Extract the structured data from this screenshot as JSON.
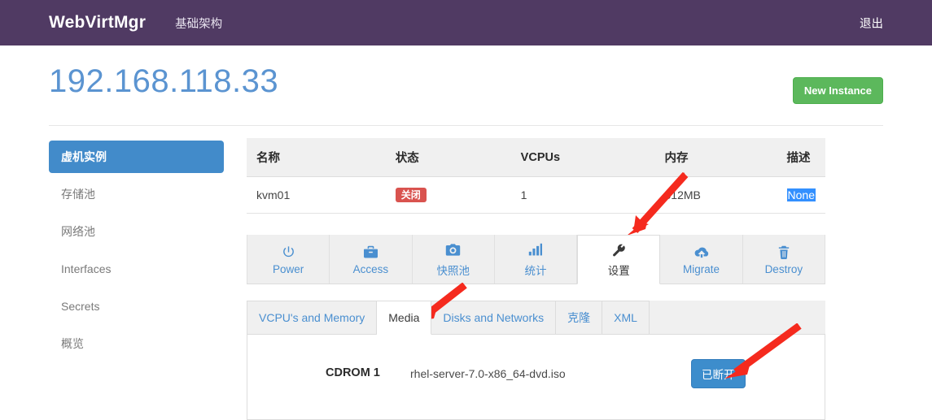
{
  "navbar": {
    "brand": "WebVirtMgr",
    "left_links": [
      {
        "label": "基础架构",
        "name": "nav-infrastructure"
      }
    ],
    "right_links": [
      {
        "label": "退出",
        "name": "nav-logout"
      }
    ],
    "bg_color": "#503a63"
  },
  "header": {
    "title": "192.168.118.33",
    "title_color": "#5b94d1",
    "new_instance_label": "New Instance",
    "new_instance_color": "#5cb85c"
  },
  "sidebar": {
    "items": [
      {
        "label": "虚机实例",
        "active": true
      },
      {
        "label": "存储池",
        "active": false
      },
      {
        "label": "网络池",
        "active": false
      },
      {
        "label": "Interfaces",
        "active": false
      },
      {
        "label": "Secrets",
        "active": false
      },
      {
        "label": "概览",
        "active": false
      }
    ],
    "active_color": "#428bca"
  },
  "instances_table": {
    "columns": [
      "名称",
      "状态",
      "VCPUs",
      "内存",
      "描述"
    ],
    "rows": [
      {
        "name": "kvm01",
        "state": "关闭",
        "state_color": "#d9534f",
        "vcpus": "1",
        "memory": "512MB",
        "description": "None",
        "description_selected": true
      }
    ]
  },
  "main_tabs": [
    {
      "label": "Power",
      "icon": "power-icon",
      "active": false
    },
    {
      "label": "Access",
      "icon": "briefcase-icon",
      "active": false
    },
    {
      "label": "快照池",
      "icon": "camera-icon",
      "active": false
    },
    {
      "label": "统计",
      "icon": "bar-chart-icon",
      "active": false
    },
    {
      "label": "设置",
      "icon": "wrench-icon",
      "active": true
    },
    {
      "label": "Migrate",
      "icon": "cloud-upload-icon",
      "active": false
    },
    {
      "label": "Destroy",
      "icon": "trash-icon",
      "active": false
    }
  ],
  "sub_tabs": [
    {
      "label": "VCPU's and Memory",
      "active": false
    },
    {
      "label": "Media",
      "active": true
    },
    {
      "label": "Disks and Networks",
      "active": false
    },
    {
      "label": "克隆",
      "active": false
    },
    {
      "label": "XML",
      "active": false
    }
  ],
  "media": {
    "device_label": "CDROM 1",
    "iso_name": "rhel-server-7.0-x86_64-dvd.iso",
    "action_label": "已断开",
    "action_color": "#3d8dcc"
  },
  "annotations": {
    "arrow_color": "#f52a1e",
    "arrows": [
      {
        "name": "arrow-to-settings-tab",
        "points_to": "设置"
      },
      {
        "name": "arrow-to-media-tab",
        "points_to": "Media"
      },
      {
        "name": "arrow-to-connect-button",
        "points_to": "已断开"
      }
    ]
  }
}
